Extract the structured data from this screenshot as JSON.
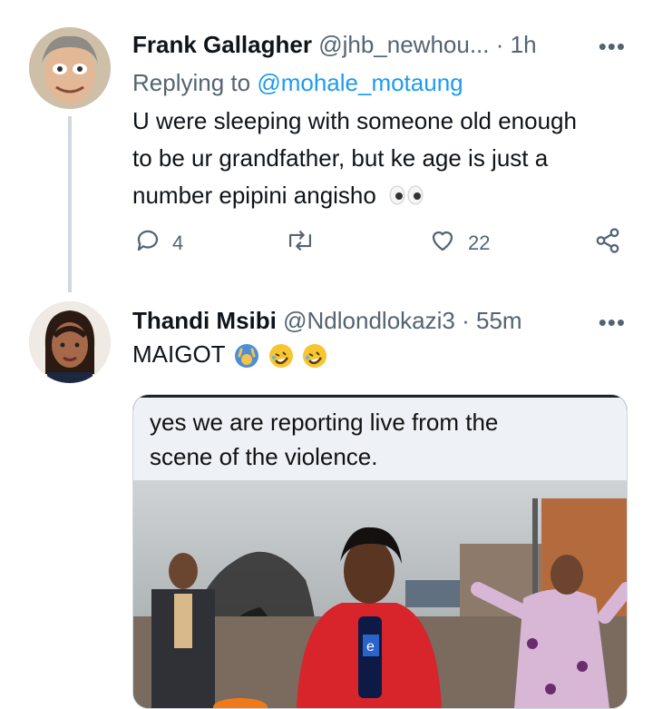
{
  "tweets": [
    {
      "name": "Frank Gallagher",
      "handle": "@jhb_newhou...",
      "separator": "·",
      "time": "1h",
      "more": "•••",
      "replying_prefix": "Replying to",
      "replying_to": "@mohale_motaung",
      "text_lines": [
        "U were sleeping with someone old enough",
        "to be ur grandfather, but ke age is just a",
        "number epipini angisho"
      ],
      "emoji": "eyes-emoji",
      "replies": "4",
      "retweets": "",
      "likes": "22"
    },
    {
      "name": "Thandi Msibi",
      "handle": "@Ndlondlokazi3",
      "separator": "·",
      "time": "55m",
      "more": "•••",
      "text": "MAIGOT",
      "emojis": [
        "person-raising-hands-emoji",
        "rolling-on-floor-laughing-emoji",
        "rolling-on-floor-laughing-emoji"
      ],
      "media": {
        "caption_lines": [
          "yes we are reporting live from the",
          "scene of the violence."
        ],
        "mic_label": "e"
      }
    }
  ],
  "colors": {
    "text": "#0f1419",
    "secondary": "#536471",
    "link": "#1d9bf0",
    "thread_line": "#cfd9de"
  }
}
